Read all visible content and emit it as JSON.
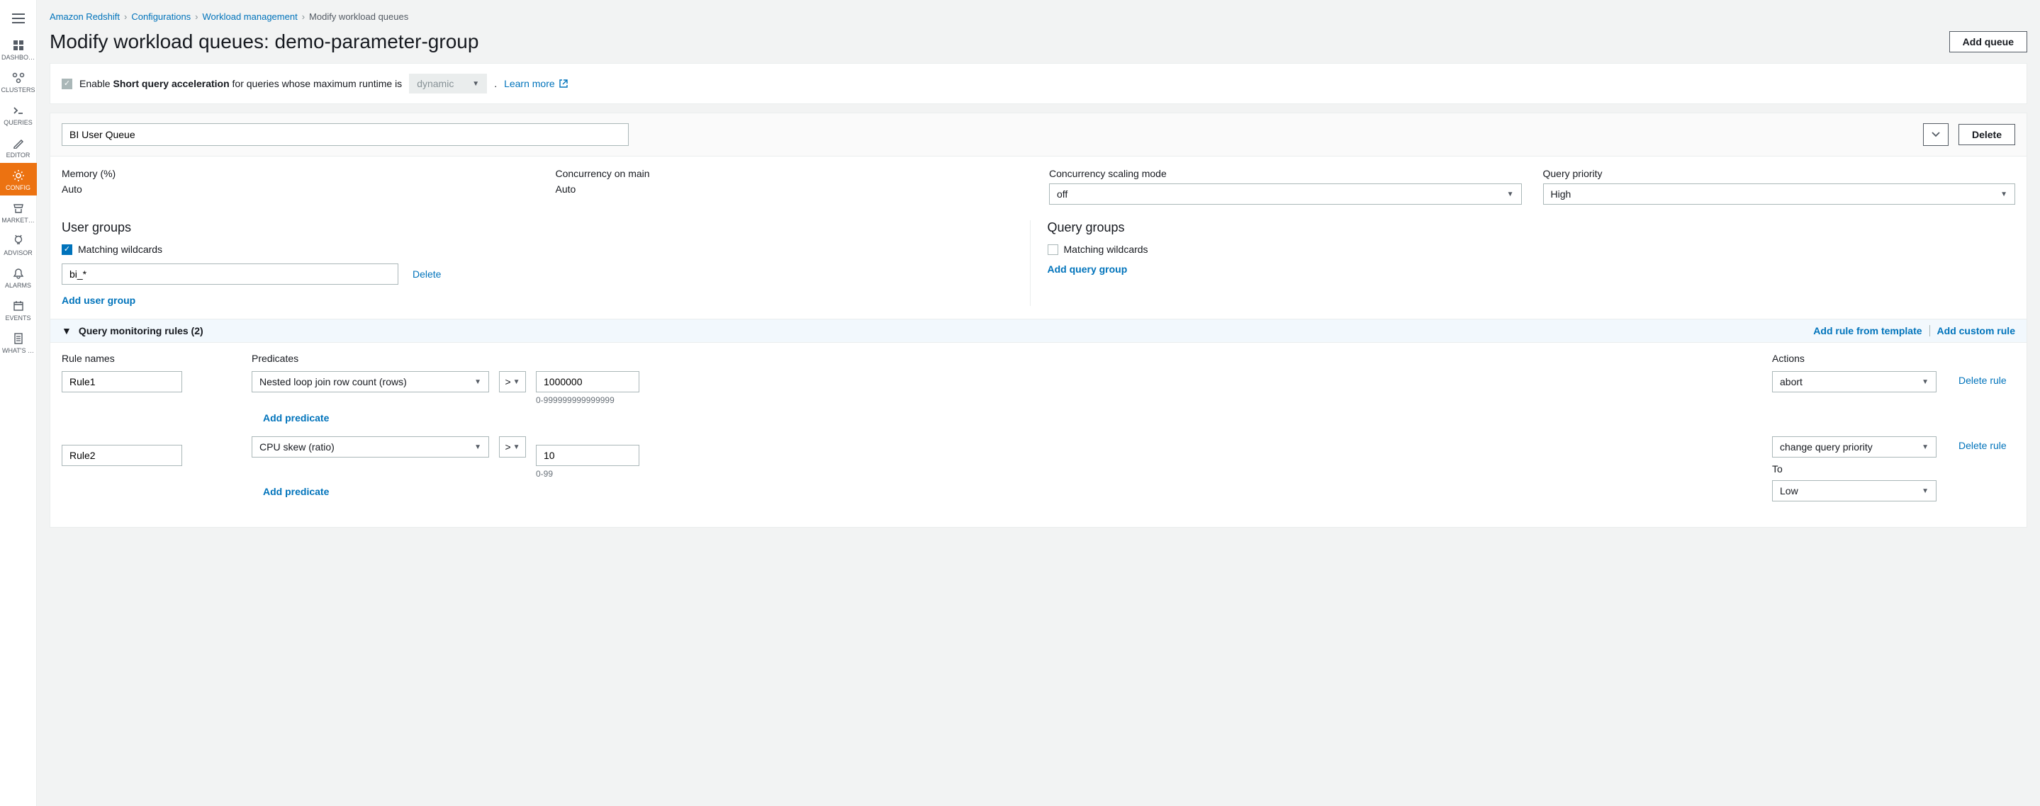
{
  "nav": {
    "items": [
      {
        "label": "DASHBO…"
      },
      {
        "label": "CLUSTERS"
      },
      {
        "label": "QUERIES"
      },
      {
        "label": "EDITOR"
      },
      {
        "label": "CONFIG"
      },
      {
        "label": "MARKET…"
      },
      {
        "label": "ADVISOR"
      },
      {
        "label": "ALARMS"
      },
      {
        "label": "EVENTS"
      },
      {
        "label": "WHAT'S …"
      }
    ]
  },
  "breadcrumbs": {
    "items": [
      {
        "text": "Amazon Redshift",
        "link": true
      },
      {
        "text": "Configurations",
        "link": true
      },
      {
        "text": "Workload management",
        "link": true
      },
      {
        "text": "Modify workload queues",
        "link": false
      }
    ]
  },
  "title": "Modify workload queues: demo-parameter-group",
  "add_queue": "Add queue",
  "sqa": {
    "enable": "Enable",
    "bold": "Short query acceleration",
    "tail": "for queries whose maximum runtime is",
    "select": "dynamic",
    "dot": ".",
    "learn": "Learn more"
  },
  "queue": {
    "name": "BI User Queue",
    "delete": "Delete",
    "fields": {
      "mem_label": "Memory (%)",
      "mem_val": "Auto",
      "conc_label": "Concurrency on main",
      "conc_val": "Auto",
      "scale_label": "Concurrency scaling mode",
      "scale_val": "off",
      "prio_label": "Query priority",
      "prio_val": "High"
    },
    "ug": {
      "title": "User groups",
      "wc": "Matching wildcards",
      "input": "bi_*",
      "del": "Delete",
      "add": "Add user group"
    },
    "qg": {
      "title": "Query groups",
      "wc": "Matching wildcards",
      "add": "Add query group"
    }
  },
  "rules": {
    "heading": "Query monitoring rules (2)",
    "tpl": "Add rule from template",
    "custom": "Add custom rule",
    "col_names": "Rule names",
    "col_pred": "Predicates",
    "col_act": "Actions",
    "rows": [
      {
        "name": "Rule1",
        "pred": "Nested loop join row count (rows)",
        "op": ">",
        "val": "1000000",
        "hint": "0-999999999999999",
        "action": "abort",
        "add": "Add predicate",
        "del": "Delete rule"
      },
      {
        "name": "Rule2",
        "pred": "CPU skew (ratio)",
        "op": ">",
        "val": "10",
        "hint": "0-99",
        "action": "change query priority",
        "to_label": "To",
        "to_val": "Low",
        "add": "Add predicate",
        "del": "Delete rule"
      }
    ]
  }
}
